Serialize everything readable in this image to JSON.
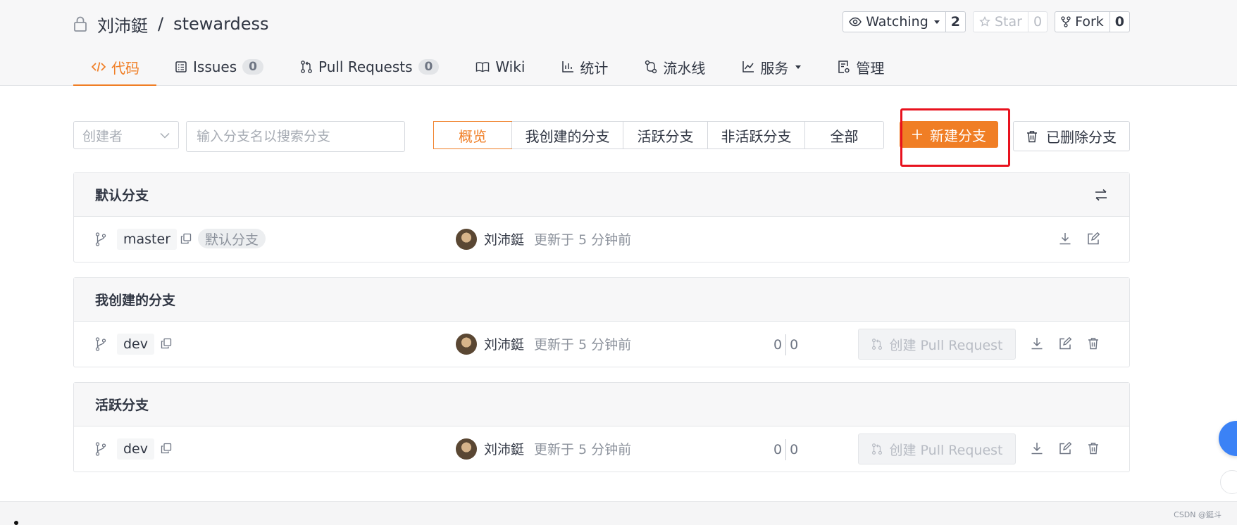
{
  "repo": {
    "owner": "刘沛鋌",
    "separator": "/",
    "name": "stewardess"
  },
  "actions": {
    "watch_label": "Watching",
    "watch_count": "2",
    "star_label": "Star",
    "star_count": "0",
    "fork_label": "Fork",
    "fork_count": "0"
  },
  "tabs": [
    {
      "label": "代码",
      "icon": "code-icon",
      "active": true
    },
    {
      "label": "Issues",
      "icon": "issues-icon",
      "badge": "0"
    },
    {
      "label": "Pull Requests",
      "icon": "pull-request-icon",
      "badge": "0"
    },
    {
      "label": "Wiki",
      "icon": "book-icon"
    },
    {
      "label": "统计",
      "icon": "bar-chart-icon"
    },
    {
      "label": "流水线",
      "icon": "pipeline-icon"
    },
    {
      "label": "服务",
      "icon": "line-chart-icon",
      "dropdown": true
    },
    {
      "label": "管理",
      "icon": "settings-doc-icon"
    }
  ],
  "toolbar": {
    "creator_placeholder": "创建者",
    "search_placeholder": "输入分支名以搜索分支",
    "filters": [
      "概览",
      "我创建的分支",
      "活跃分支",
      "非活跃分支",
      "全部"
    ],
    "active_filter": "概览",
    "new_branch_label": "新建分支",
    "deleted_branches_label": "已删除分支"
  },
  "sections": [
    {
      "title": "默认分支",
      "rows": [
        {
          "branch": "master",
          "default_tag": "默认分支",
          "author": "刘沛鋌",
          "updated": "更新于 5 分钟前"
        }
      ]
    },
    {
      "title": "我创建的分支",
      "rows": [
        {
          "branch": "dev",
          "author": "刘沛鋌",
          "updated": "更新于 5 分钟前",
          "behind": "0",
          "ahead": "0",
          "pr_label": "创建 Pull Request"
        }
      ]
    },
    {
      "title": "活跃分支",
      "rows": [
        {
          "branch": "dev",
          "author": "刘沛鋌",
          "updated": "更新于 5 分钟前",
          "behind": "0",
          "ahead": "0",
          "pr_label": "创建 Pull Request"
        }
      ]
    }
  ],
  "watermark": "CSDN @鋌斗",
  "colors": {
    "accent": "#f07e25",
    "highlight": "#e8121e"
  }
}
